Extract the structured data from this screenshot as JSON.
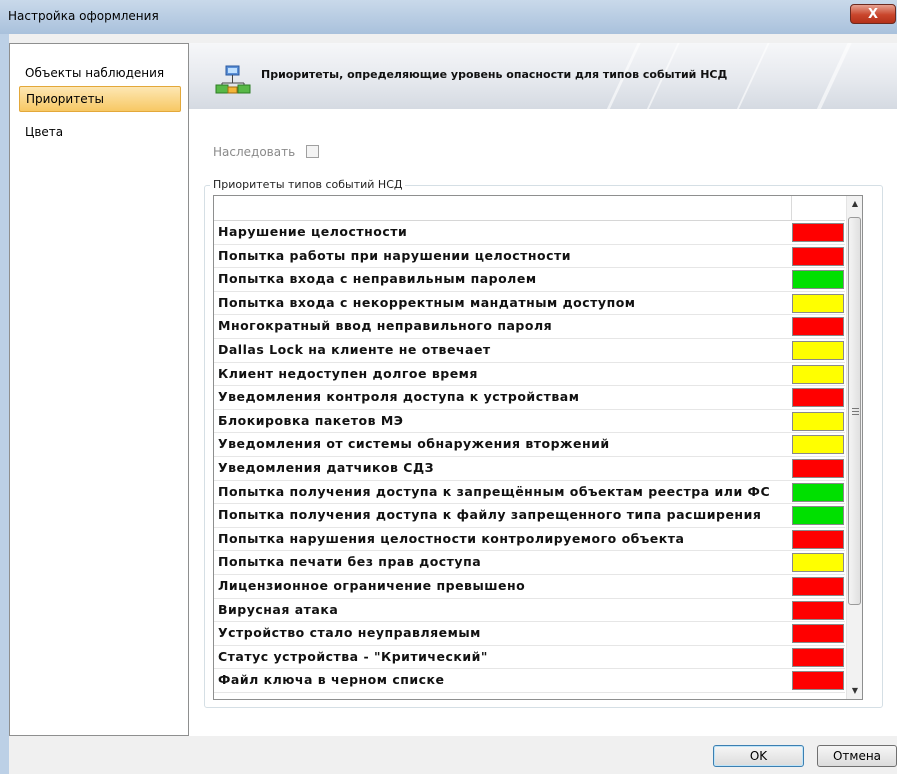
{
  "window": {
    "title": "Настройка оформления",
    "close_label": "X"
  },
  "nav": {
    "items": [
      {
        "label": "Объекты наблюдения",
        "selected": false
      },
      {
        "label": "Приоритеты",
        "selected": true
      },
      {
        "label": "Цвета",
        "selected": false
      }
    ]
  },
  "header": {
    "title": "Приоритеты, определяющие уровень опасности для типов событий НСД",
    "icon": "network-icon"
  },
  "inherit": {
    "label": "Наследовать",
    "checked": false
  },
  "group": {
    "label": "Приоритеты типов событий НСД"
  },
  "priorities": [
    {
      "label": "Нарушение целостности",
      "color": "#ff0000"
    },
    {
      "label": "Попытка работы при нарушении целостности",
      "color": "#ff0000"
    },
    {
      "label": "Попытка входа с неправильным паролем",
      "color": "#00e000"
    },
    {
      "label": "Попытка входа с некорректным мандатным доступом",
      "color": "#ffff00"
    },
    {
      "label": "Многократный ввод неправильного пароля",
      "color": "#ff0000"
    },
    {
      "label": "Dallas Lock на клиенте не отвечает",
      "color": "#ffff00"
    },
    {
      "label": "Клиент недоступен долгое время",
      "color": "#ffff00"
    },
    {
      "label": "Уведомления контроля доступа к устройствам",
      "color": "#ff0000"
    },
    {
      "label": "Блокировка пакетов МЭ",
      "color": "#ffff00"
    },
    {
      "label": "Уведомления от системы обнаружения вторжений",
      "color": "#ffff00"
    },
    {
      "label": "Уведомления датчиков СДЗ",
      "color": "#ff0000"
    },
    {
      "label": "Попытка получения доступа к запрещённым объектам реестра или ФС",
      "color": "#00e000"
    },
    {
      "label": "Попытка получения доступа к файлу запрещенного типа расширения",
      "color": "#00e000"
    },
    {
      "label": "Попытка нарушения целостности контролируемого объекта",
      "color": "#ff0000"
    },
    {
      "label": "Попытка печати без прав доступа",
      "color": "#ffff00"
    },
    {
      "label": "Лицензионное ограничение превышено",
      "color": "#ff0000"
    },
    {
      "label": "Вирусная атака",
      "color": "#ff0000"
    },
    {
      "label": "Устройство стало неуправляемым",
      "color": "#ff0000"
    },
    {
      "label": "Статус устройства - \"Критический\"",
      "color": "#ff0000"
    },
    {
      "label": "Файл ключа в черном списке",
      "color": "#ff0000"
    }
  ],
  "buttons": {
    "ok": "OK",
    "cancel": "Отмена"
  }
}
